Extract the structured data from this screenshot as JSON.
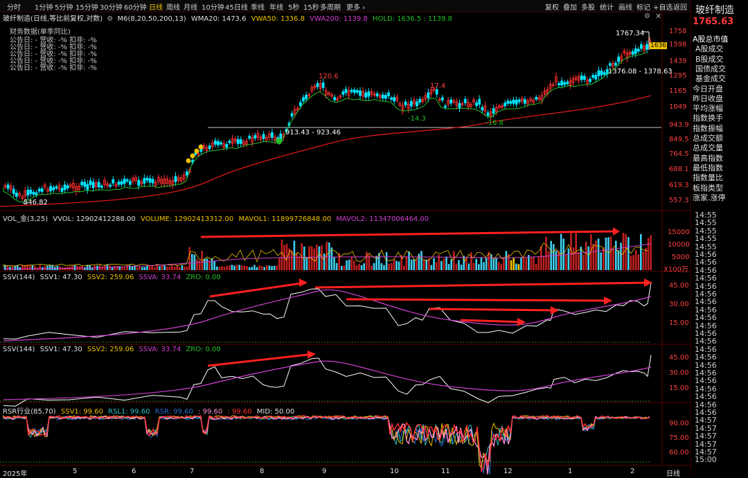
{
  "toolbar": {
    "periods": [
      "分时",
      "1分钟",
      "5分钟",
      "15分钟",
      "30分钟",
      "60分钟",
      "日线",
      "周线",
      "月线",
      "10分钟",
      "45日线",
      "季线",
      "年线",
      "5秒",
      "15秒",
      "多周期",
      "更多 ›"
    ],
    "active_period": "日线",
    "right_buttons": [
      "复权",
      "叠加",
      "多股",
      "统计",
      "画线",
      "标记",
      "+自选",
      "返回"
    ]
  },
  "main_legend": {
    "title": "玻纤制造(日线,等比前复权,对数)",
    "m6": "M6(8,20,50,200,13)",
    "wma20": "WMA20: 1473.6",
    "vwa50": "VWA50: 1336.8",
    "vwa200": "VWA200: 1139.8",
    "hold": "HOLD: 1636.5 : 1139.8"
  },
  "financial": {
    "header": "财务数据(单季同比)",
    "rows": [
      "公告日: -   营收: -%   扣非: -%",
      "公告日: -   营收: -%   扣非: -%",
      "公告日: -   营收: -%   扣非: -%",
      "公告日: -   营收: -%   扣非: -%",
      "公告日: -   营收: -%   扣非: -%"
    ]
  },
  "price_axis": [
    "1758",
    "1598",
    "1439",
    "1295",
    "1165",
    "1049",
    "943.9",
    "849.5",
    "764.5",
    "688.1",
    "619.3",
    "557.3"
  ],
  "annotations": {
    "high": "1767.34",
    "low": "546.82",
    "peak1": "120.6",
    "peak2": "17.4",
    "trough1": "-14.3",
    "trough2": "-16.8",
    "range1": "913.43 - 923.46",
    "range2": "1376.08 - 1378.63",
    "current_tag": "1636"
  },
  "volume_legend": {
    "name": "VOL_金(3,25)",
    "vvol": "VVOL: 12902412288.00",
    "volume": "VOLUME: 12902413312.00",
    "mavol1": "MAVOL1: 11899726848.00",
    "mavol2": "MAVOL2: 11347006464.00"
  },
  "volume_axis": [
    "15000",
    "10000",
    "5000"
  ],
  "volume_unit": "X100万",
  "ssv_legend": {
    "name": "SSV(144)",
    "ssv1": "SSV1: 47.30",
    "ssv2": "SSV2: 259.06",
    "ssva": "SSVA: 33.74",
    "zro": "ZRO: 0.00"
  },
  "ssv_axis": [
    "45.00",
    "30.00",
    "15.00"
  ],
  "rsr_legend": {
    "name": "RSR行业(85,70)",
    "ssv1": "SSV1: 99.60",
    "rsl1": "RSL1: 99.60",
    "rsr": "RSR: 99.60",
    "blank1": ": 99.60",
    "blank2": ": 99.60",
    "mid": "MID: 50.00"
  },
  "rsr_axis": [
    "90.00",
    "75.00",
    "60.00"
  ],
  "x_axis": [
    "2025年",
    "5",
    "6",
    "7",
    "8",
    "9",
    "10",
    "11",
    "12",
    "1",
    "2"
  ],
  "x_period": "日线",
  "sidebar": {
    "title": "玻纤制造",
    "price": "1765.63",
    "items": [
      "A股总市值",
      "A股成交",
      "B股成交",
      "国债成交",
      "基金成交",
      "今日开盘",
      "昨日收盘",
      "平均涨幅",
      "指数换手",
      "指数振幅",
      "总成交额",
      "总成交量",
      "最高指数",
      "最低指数",
      "指数量比",
      "板指类型",
      "涨家.涨停"
    ],
    "times": [
      "14:55",
      "14:55",
      "14:55",
      "14:55",
      "14:55",
      "14:56",
      "14:56",
      "14:56",
      "14:56",
      "14:56",
      "14:56",
      "14:56",
      "14:56",
      "14:56",
      "14:56",
      "14:56",
      "14:56",
      "14:56",
      "14:56",
      "14:56",
      "14:56",
      "14:56",
      "14:56",
      "14:56",
      "14:56",
      "14:56",
      "14:57",
      "14:57",
      "14:57",
      "14:57",
      "14:57",
      "15:00"
    ]
  },
  "colors": {
    "up": "#ff3030",
    "down": "#00e5ff",
    "ma_green": "#22c02a",
    "ma_red": "#e01818",
    "accent": "#f0c200",
    "magenta": "#d040d0"
  }
}
